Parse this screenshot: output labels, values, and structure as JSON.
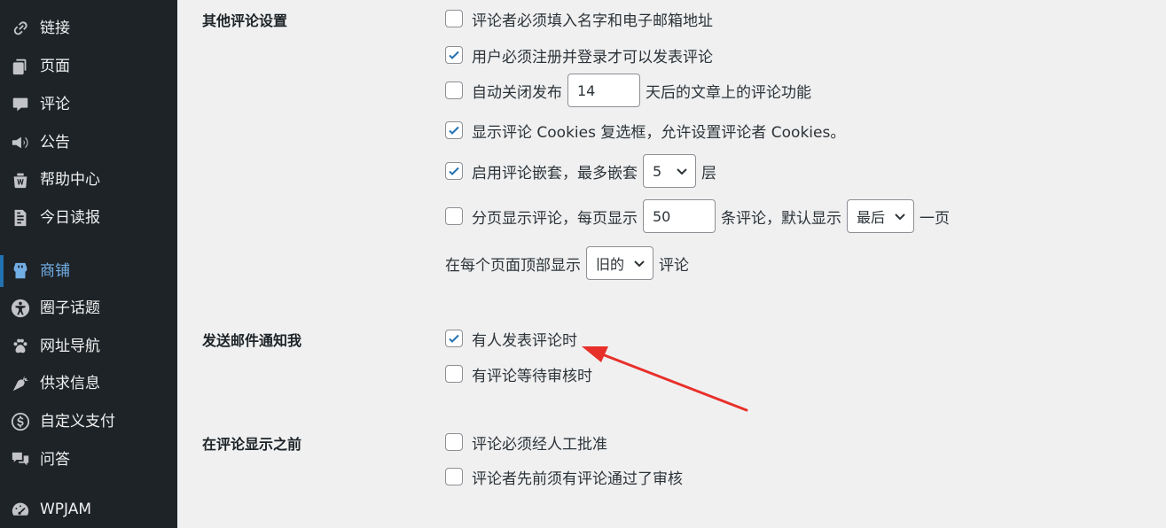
{
  "sidebar": {
    "items": [
      {
        "label": "链接",
        "icon": "link-icon"
      },
      {
        "label": "页面",
        "icon": "pages-icon"
      },
      {
        "label": "评论",
        "icon": "comment-icon"
      },
      {
        "label": "公告",
        "icon": "megaphone-icon"
      },
      {
        "label": "帮助中心",
        "icon": "help-center-icon"
      },
      {
        "label": "今日读报",
        "icon": "newspaper-icon"
      },
      {
        "label": "商铺",
        "icon": "store-icon",
        "current": true
      },
      {
        "label": "圈子话题",
        "icon": "accessibility-icon"
      },
      {
        "label": "网址导航",
        "icon": "paw-icon"
      },
      {
        "label": "供求信息",
        "icon": "carrot-icon"
      },
      {
        "label": "自定义支付",
        "icon": "money-icon"
      },
      {
        "label": "问答",
        "icon": "chat-bubbles-icon"
      },
      {
        "label": "WPJAM",
        "icon": "dashboard-gauge-icon"
      }
    ]
  },
  "settings": {
    "other": {
      "label": "其他评论设置",
      "require_name_email": {
        "label": "评论者必须填入名字和电子邮箱地址",
        "checked": false
      },
      "registration_required": {
        "label": "用户必须注册并登录才可以发表评论",
        "checked": true
      },
      "close_comments": {
        "prefix": "自动关闭发布",
        "value": "14",
        "suffix": "天后的文章上的评论功能",
        "checked": false
      },
      "cookies_opt_in": {
        "label": "显示评论 Cookies 复选框，允许设置评论者 Cookies。",
        "checked": true
      },
      "thread_comments": {
        "prefix": "启用评论嵌套，最多嵌套",
        "value": "5",
        "suffix": "层",
        "checked": true
      },
      "page_comments": {
        "prefix": "分页显示评论，每页显示",
        "per_page": "50",
        "middle": "条评论，默认显示",
        "default_page": "最后",
        "suffix": "一页",
        "checked": false
      },
      "comment_order": {
        "prefix": "在每个页面顶部显示",
        "value": "旧的",
        "suffix": "评论"
      }
    },
    "email": {
      "label": "发送邮件通知我",
      "comments_notify": {
        "label": "有人发表评论时",
        "checked": true
      },
      "moderation_notify": {
        "label": "有评论等待审核时",
        "checked": false
      }
    },
    "before": {
      "label": "在评论显示之前",
      "comment_moderation": {
        "label": "评论必须经人工批准",
        "checked": false
      },
      "comment_previously_approved": {
        "label": "评论者先前须有评论通过了审核",
        "checked": false
      }
    }
  },
  "colors": {
    "accent": "#2271b1",
    "arrow": "#e8302a",
    "sidebar_bg": "#1d2327"
  }
}
